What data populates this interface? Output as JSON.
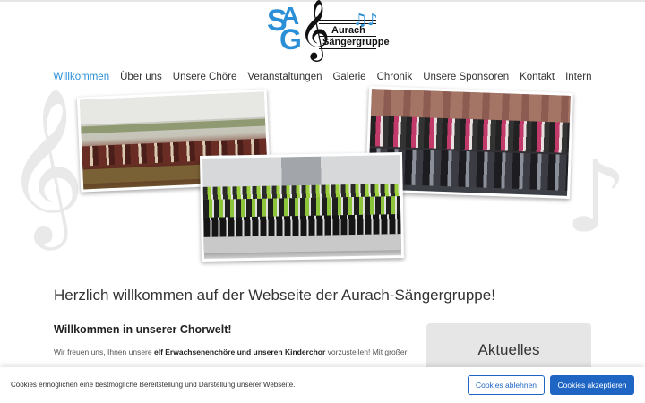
{
  "logo": {
    "letters": [
      "S",
      "A",
      "G"
    ],
    "line1": "Aurach",
    "line2": "Sängergruppe",
    "icon": "treble-clef-icon"
  },
  "nav": {
    "items": [
      {
        "label": "Willkommen",
        "active": true
      },
      {
        "label": "Über uns"
      },
      {
        "label": "Unsere Chöre"
      },
      {
        "label": "Veranstaltungen"
      },
      {
        "label": "Galerie"
      },
      {
        "label": "Chronik"
      },
      {
        "label": "Unsere Sponsoren"
      },
      {
        "label": "Kontakt"
      },
      {
        "label": "Intern"
      }
    ]
  },
  "hero": {
    "decorations": [
      "treble-clef-icon",
      "music-note-icon"
    ],
    "photos": [
      "choir-photo",
      "choir-photo",
      "choir-photo"
    ]
  },
  "main": {
    "headline": "Herzlich willkommen auf der Webseite der Aurach-Sängergruppe!",
    "subhead": "Willkommen in unserer Chorwelt!",
    "intro_prefix": "Wir freuen uns, Ihnen unsere ",
    "intro_bold": "elf Erwachsenenchöre und unseren Kinderchor",
    "intro_suffix": " vorzustellen! Mit großer"
  },
  "sidebar": {
    "title": "Aktuelles"
  },
  "cookie": {
    "message": "Cookies ermöglichen eine bestmögliche Bereitstellung und Darstellung unserer Webseite.",
    "decline_label": "Cookies ablehnen",
    "accept_label": "Cookies akzeptieren"
  },
  "colors": {
    "accent": "#2a8fd6",
    "button": "#1f66c4"
  }
}
